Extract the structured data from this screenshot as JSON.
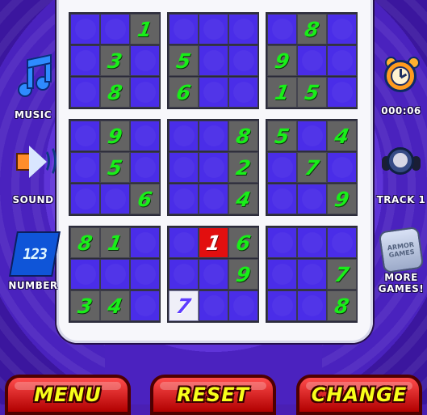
{
  "left_tools": [
    {
      "label": "MUSIC"
    },
    {
      "label": "SOUND"
    },
    {
      "label": "NUMBER",
      "icon_text": "123"
    }
  ],
  "right_tools": [
    {
      "label": "000:06"
    },
    {
      "label": "TRACK 1"
    },
    {
      "label_line1": "MORE",
      "label_line2": "GAMES!",
      "icon_text_line1": "ARMOR",
      "icon_text_line2": "GAMES"
    }
  ],
  "board": {
    "cells": [
      [
        "",
        "",
        "1",
        "",
        "",
        "",
        "",
        "8",
        ""
      ],
      [
        "",
        "3",
        "",
        "5",
        "",
        "",
        "9",
        "",
        ""
      ],
      [
        "",
        "8",
        "",
        "6",
        "",
        "",
        "1",
        "5",
        ""
      ],
      [
        "",
        "9",
        "",
        "",
        "",
        "8",
        "5",
        "",
        "4"
      ],
      [
        "",
        "5",
        "",
        "",
        "",
        "2",
        "",
        "7",
        ""
      ],
      [
        "",
        "",
        "6",
        "",
        "",
        "4",
        "",
        "",
        "9"
      ],
      [
        "8",
        "1",
        "",
        "",
        "1",
        "6",
        "",
        "",
        ""
      ],
      [
        "",
        "",
        "",
        "",
        "",
        "9",
        "",
        "",
        "7"
      ],
      [
        "3",
        "4",
        "",
        "7",
        "",
        "",
        "",
        "",
        "8"
      ]
    ],
    "selected_cell": "r6c4",
    "entered_cell": "r8c3"
  },
  "buttons": {
    "menu": "MENU",
    "reset": "RESET",
    "change": "CHANGE"
  }
}
